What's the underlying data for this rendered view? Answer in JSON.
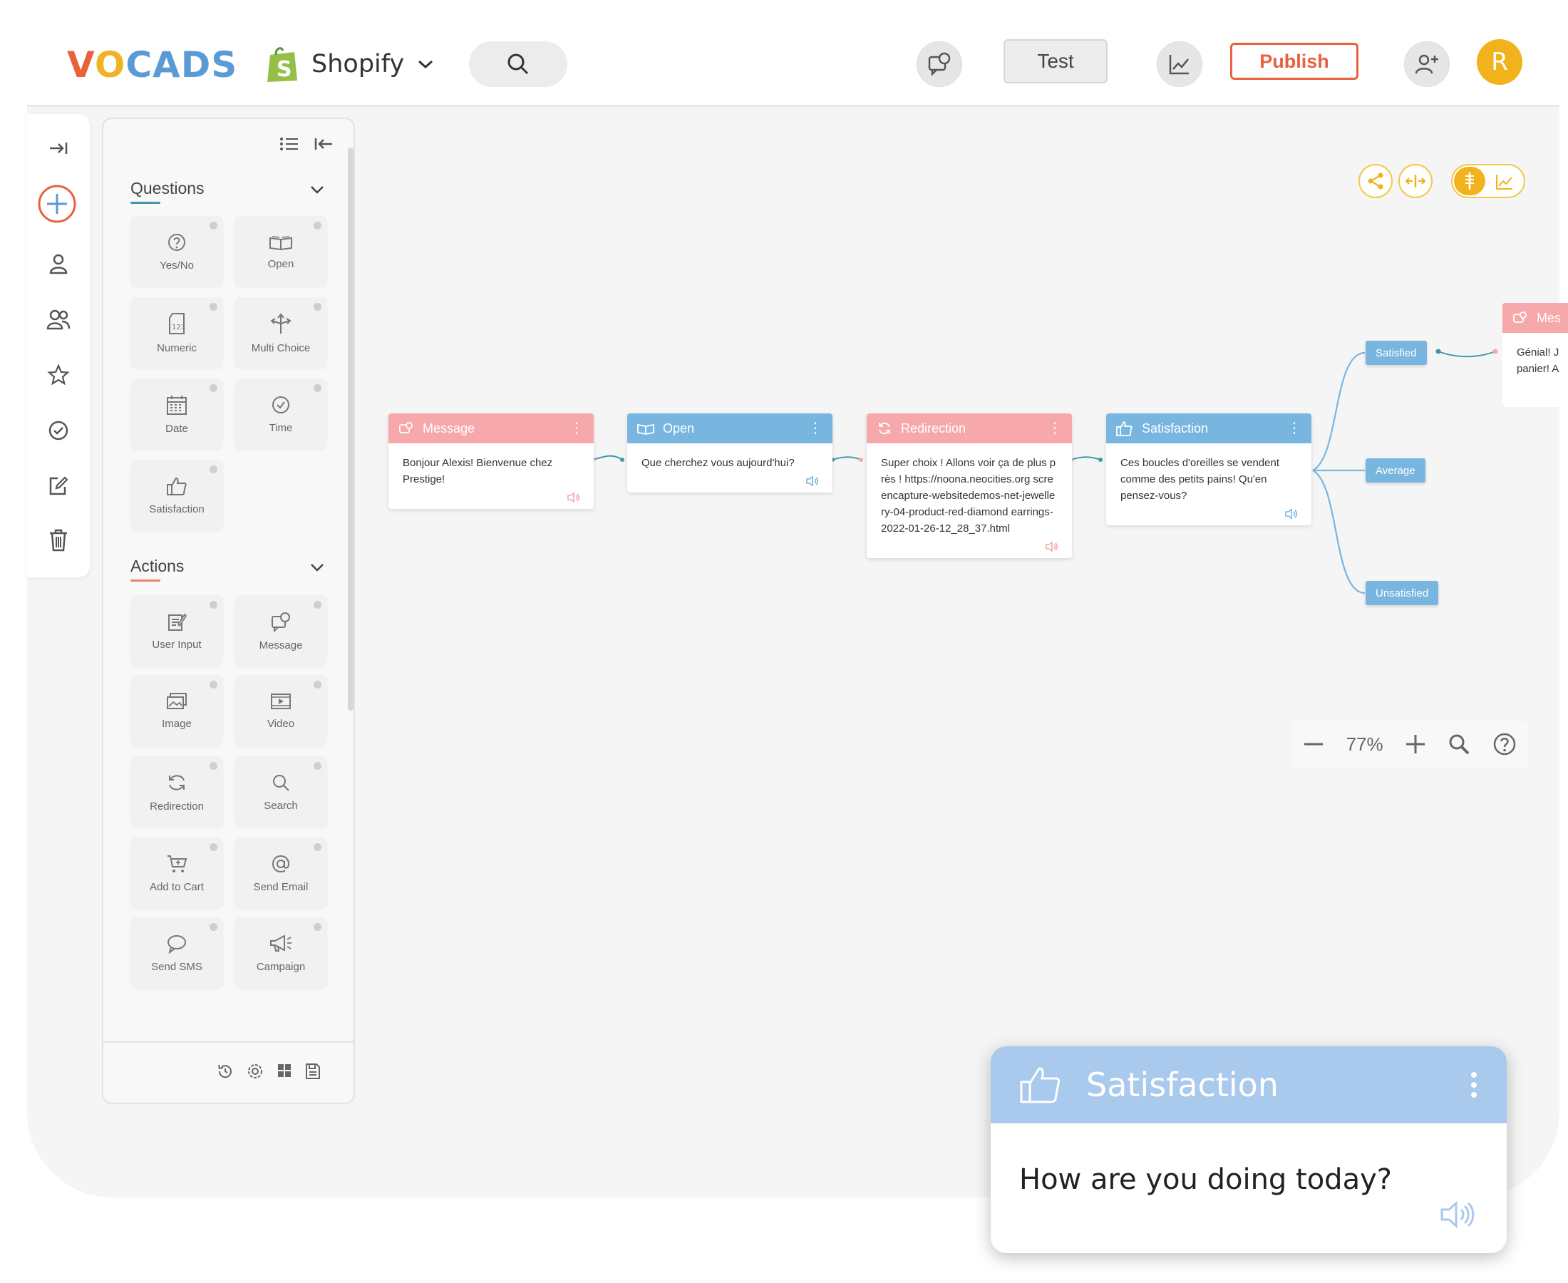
{
  "app": {
    "logo": {
      "part1": "V",
      "part2": "O",
      "part3": "CADS"
    },
    "store_label": "Shopify"
  },
  "header": {
    "test_label": "Test",
    "publish_label": "Publish",
    "avatar_initial": "R"
  },
  "toolbox": {
    "questions_title": "Questions",
    "questions": [
      {
        "label": "Yes/No",
        "icon": "question-circle-icon"
      },
      {
        "label": "Open",
        "icon": "open-book-icon"
      },
      {
        "label": "Numeric",
        "icon": "numeric-icon"
      },
      {
        "label": "Multi Choice",
        "icon": "multi-choice-icon"
      },
      {
        "label": "Date",
        "icon": "calendar-icon"
      },
      {
        "label": "Time",
        "icon": "clock-icon"
      },
      {
        "label": "Satisfaction",
        "icon": "thumbs-up-icon"
      }
    ],
    "actions_title": "Actions",
    "actions": [
      {
        "label": "User Input",
        "icon": "user-input-icon"
      },
      {
        "label": "Message",
        "icon": "message-icon"
      },
      {
        "label": "Image",
        "icon": "image-icon"
      },
      {
        "label": "Video",
        "icon": "video-icon"
      },
      {
        "label": "Redirection",
        "icon": "refresh-icon"
      },
      {
        "label": "Search",
        "icon": "search-icon"
      },
      {
        "label": "Add to Cart",
        "icon": "cart-icon"
      },
      {
        "label": "Send Email",
        "icon": "at-icon"
      },
      {
        "label": "Send SMS",
        "icon": "chat-bubble-icon"
      },
      {
        "label": "Campaign",
        "icon": "megaphone-icon"
      }
    ]
  },
  "flow": {
    "nodes": [
      {
        "type": "Message",
        "text": "Bonjour Alexis! Bienvenue chez Prestige!"
      },
      {
        "type": "Open",
        "text": "Que cherchez vous aujourd'hui?"
      },
      {
        "type": "Redirection",
        "text": "Super choix ! Allons voir ça de plus près ! https://noona.neocities.org screencapture-websitedemos-net-jewellery-04-product-red-diamond earrings-2022-01-26-12_28_37.html"
      },
      {
        "type": "Satisfaction",
        "text": "Ces boucles d'oreilles se vendent comme des petits pains! Qu'en pensez-vous?"
      }
    ],
    "outcomes": [
      "Satisfied",
      "Average",
      "Unsatisfied"
    ],
    "partial_node": {
      "type": "Mes",
      "line1": "Génial! J",
      "line2": "panier! A"
    }
  },
  "zoom": {
    "value": "77%"
  },
  "preview": {
    "title": "Satisfaction",
    "text": "How are you doing today?"
  },
  "colors": {
    "accent_orange": "#e8603c",
    "accent_blue": "#5b9bd5",
    "accent_yellow": "#f2b21b",
    "node_pink": "#f7a8ab",
    "node_blue": "#78b6e0"
  }
}
